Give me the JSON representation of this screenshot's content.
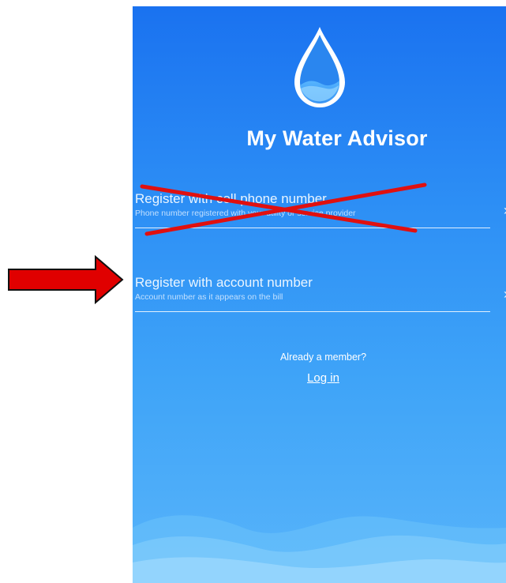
{
  "app": {
    "title": "My Water Advisor"
  },
  "options": [
    {
      "title": "Register with cell phone number",
      "subtitle": "Phone number registered with your utility or service provider",
      "chevron": "›",
      "struck_out": true
    },
    {
      "title": "Register with account number",
      "subtitle": "Account number as it appears on the bill",
      "chevron": "›",
      "struck_out": false
    }
  ],
  "member": {
    "prompt": "Already a member?",
    "login_label": "Log in"
  },
  "colors": {
    "background_top": "#1a72f0",
    "background_bottom": "#58b4fa",
    "annotation_red": "#e01010",
    "arrow_fill": "#e00000"
  },
  "icons": {
    "logo": "water-drop-icon",
    "chevron": "chevron-right-icon"
  }
}
